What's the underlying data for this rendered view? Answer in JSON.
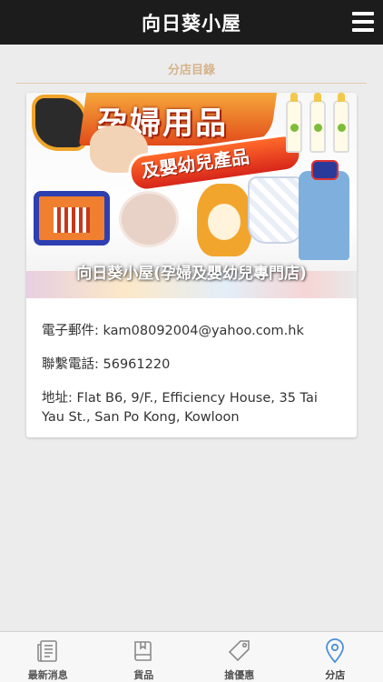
{
  "header": {
    "title": "向日葵小屋",
    "menu_icon": "hamburger-icon"
  },
  "section": {
    "title": "分店目錄"
  },
  "store": {
    "banner": {
      "heading": "孕婦用品",
      "subheading": "及嬰幼兒產品",
      "overlay_text": "向日葵小屋(孕婦及嬰幼兒專門店)"
    },
    "email": "電子郵件: kam08092004@yahoo.com.hk",
    "phone": "聯繫電話: 56961220",
    "address": "地址: Flat B6, 9/F., Efficiency House, 35 Tai Yau St., San Po Kong, Kowloon"
  },
  "tabbar": {
    "accent": "#4a90d9",
    "items": [
      {
        "label": "最新消息",
        "icon": "news-icon",
        "active": false
      },
      {
        "label": "貨品",
        "icon": "book-icon",
        "active": false
      },
      {
        "label": "搶優惠",
        "icon": "tag-icon",
        "active": false
      },
      {
        "label": "分店",
        "icon": "location-pin-icon",
        "active": true
      }
    ]
  }
}
